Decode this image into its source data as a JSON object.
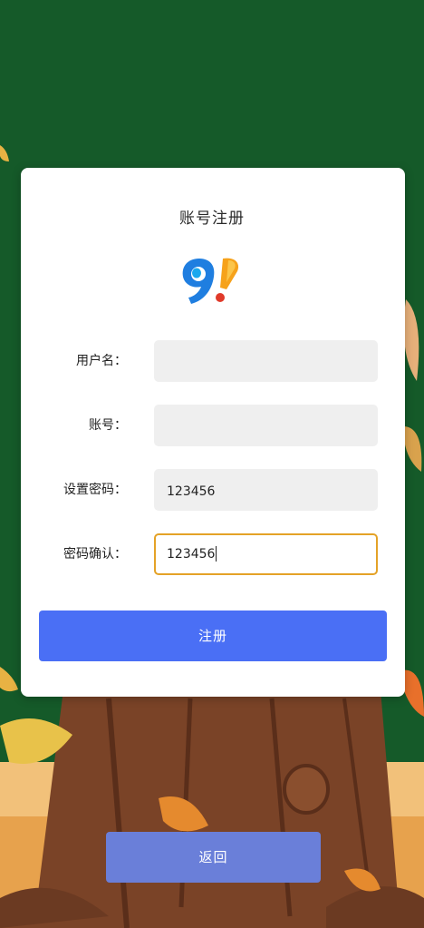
{
  "form": {
    "title": "账号注册",
    "username": {
      "label": "用户名：",
      "value": ""
    },
    "account": {
      "label": "账号：",
      "value": ""
    },
    "password": {
      "label": "设置密码：",
      "value": "123456"
    },
    "confirm_password": {
      "label": "密码确认：",
      "value": "123456"
    },
    "submit_label": "注册"
  },
  "back_label": "返回",
  "colors": {
    "background_green": "#155a29",
    "primary_button": "#4a6ff5",
    "secondary_button": "#6a7fd9",
    "focus_border": "#e4a227",
    "field_bg": "#efefef"
  }
}
